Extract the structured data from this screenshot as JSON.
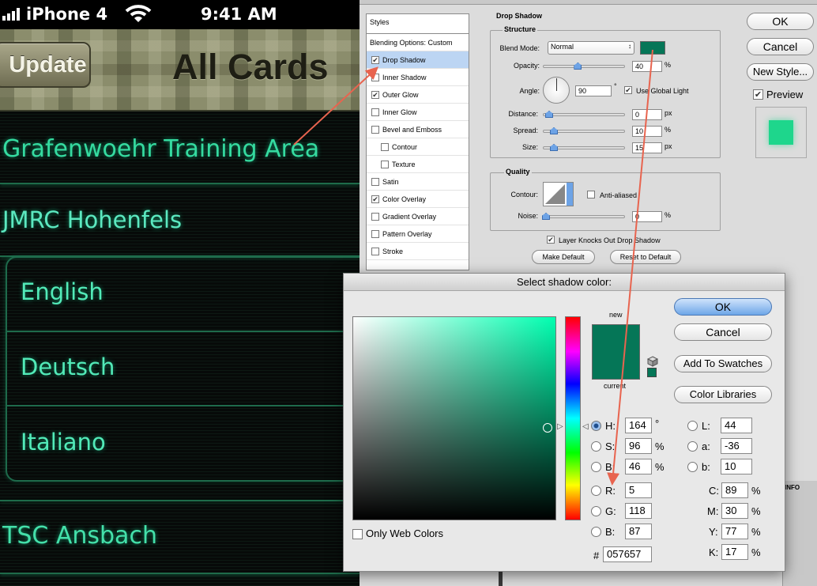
{
  "iphone": {
    "status": {
      "carrier": "iPhone 4",
      "time": "9:41 AM"
    },
    "nav": {
      "update_label": "Update",
      "title": "All Cards"
    },
    "rows": [
      "Grafenwoehr Training Area",
      "JMRC Hohenfels",
      "TSC Ansbach"
    ],
    "group_rows": [
      "English",
      "Deutsch",
      "Italiano"
    ]
  },
  "layer_style": {
    "styles_header": "Styles",
    "styles": [
      {
        "label": "Blending Options: Custom",
        "checkbox": false,
        "checked": false,
        "indent": false
      },
      {
        "label": "Drop Shadow",
        "checkbox": true,
        "checked": true,
        "indent": false,
        "selected": true
      },
      {
        "label": "Inner Shadow",
        "checkbox": true,
        "checked": false,
        "indent": false
      },
      {
        "label": "Outer Glow",
        "checkbox": true,
        "checked": true,
        "indent": false
      },
      {
        "label": "Inner Glow",
        "checkbox": true,
        "checked": false,
        "indent": false
      },
      {
        "label": "Bevel and Emboss",
        "checkbox": true,
        "checked": false,
        "indent": false
      },
      {
        "label": "Contour",
        "checkbox": true,
        "checked": false,
        "indent": true
      },
      {
        "label": "Texture",
        "checkbox": true,
        "checked": false,
        "indent": true
      },
      {
        "label": "Satin",
        "checkbox": true,
        "checked": false,
        "indent": false
      },
      {
        "label": "Color Overlay",
        "checkbox": true,
        "checked": true,
        "indent": false
      },
      {
        "label": "Gradient Overlay",
        "checkbox": true,
        "checked": false,
        "indent": false
      },
      {
        "label": "Pattern Overlay",
        "checkbox": true,
        "checked": false,
        "indent": false
      },
      {
        "label": "Stroke",
        "checkbox": true,
        "checked": false,
        "indent": false
      }
    ],
    "section_title": "Drop Shadow",
    "structure": {
      "title": "Structure",
      "blend_mode_label": "Blend Mode:",
      "blend_mode_value": "Normal",
      "shadow_color": "#057657",
      "opacity_label": "Opacity:",
      "opacity": "40",
      "opacity_fraction": 0.4,
      "angle_label": "Angle:",
      "angle": "90",
      "use_global_light": "Use Global Light",
      "distance_label": "Distance:",
      "distance": "0",
      "spread_label": "Spread:",
      "spread": "10",
      "size_label": "Size:",
      "size": "15",
      "px": "px",
      "pct": "%",
      "deg": "°"
    },
    "quality": {
      "title": "Quality",
      "contour_label": "Contour:",
      "anti_aliased": "Anti-aliased",
      "noise_label": "Noise:",
      "noise": "0"
    },
    "layer_knocks_out": "Layer Knocks Out Drop Shadow",
    "make_default": "Make Default",
    "reset_default": "Reset to Default",
    "buttons": {
      "ok": "OK",
      "cancel": "Cancel",
      "new_style": "New Style...",
      "preview": "Preview"
    },
    "preview_color": "#1ed68c",
    "info_tab": "INFO"
  },
  "color_picker": {
    "title": "Select shadow color:",
    "new_label": "new",
    "current_label": "current",
    "new_color": "#057657",
    "current_color": "#057657",
    "buttons": {
      "ok": "OK",
      "cancel": "Cancel",
      "add_swatches": "Add To Swatches",
      "color_libraries": "Color Libraries"
    },
    "only_web_colors": "Only Web Colors",
    "hsb": [
      {
        "k": "H:",
        "v": "164",
        "u": "°"
      },
      {
        "k": "S:",
        "v": "96",
        "u": "%"
      },
      {
        "k": "B:",
        "v": "46",
        "u": "%"
      }
    ],
    "rgb": [
      {
        "k": "R:",
        "v": "5"
      },
      {
        "k": "G:",
        "v": "118"
      },
      {
        "k": "B:",
        "v": "87"
      }
    ],
    "lab": [
      {
        "k": "L:",
        "v": "44"
      },
      {
        "k": "a:",
        "v": "-36"
      },
      {
        "k": "b:",
        "v": "10"
      }
    ],
    "cmyk": [
      {
        "k": "C:",
        "v": "89"
      },
      {
        "k": "M:",
        "v": "30"
      },
      {
        "k": "Y:",
        "v": "77"
      },
      {
        "k": "K:",
        "v": "17"
      }
    ],
    "pct": "%",
    "hex_label": "#",
    "hex": "057657"
  },
  "annotation_color": "#e8644f"
}
